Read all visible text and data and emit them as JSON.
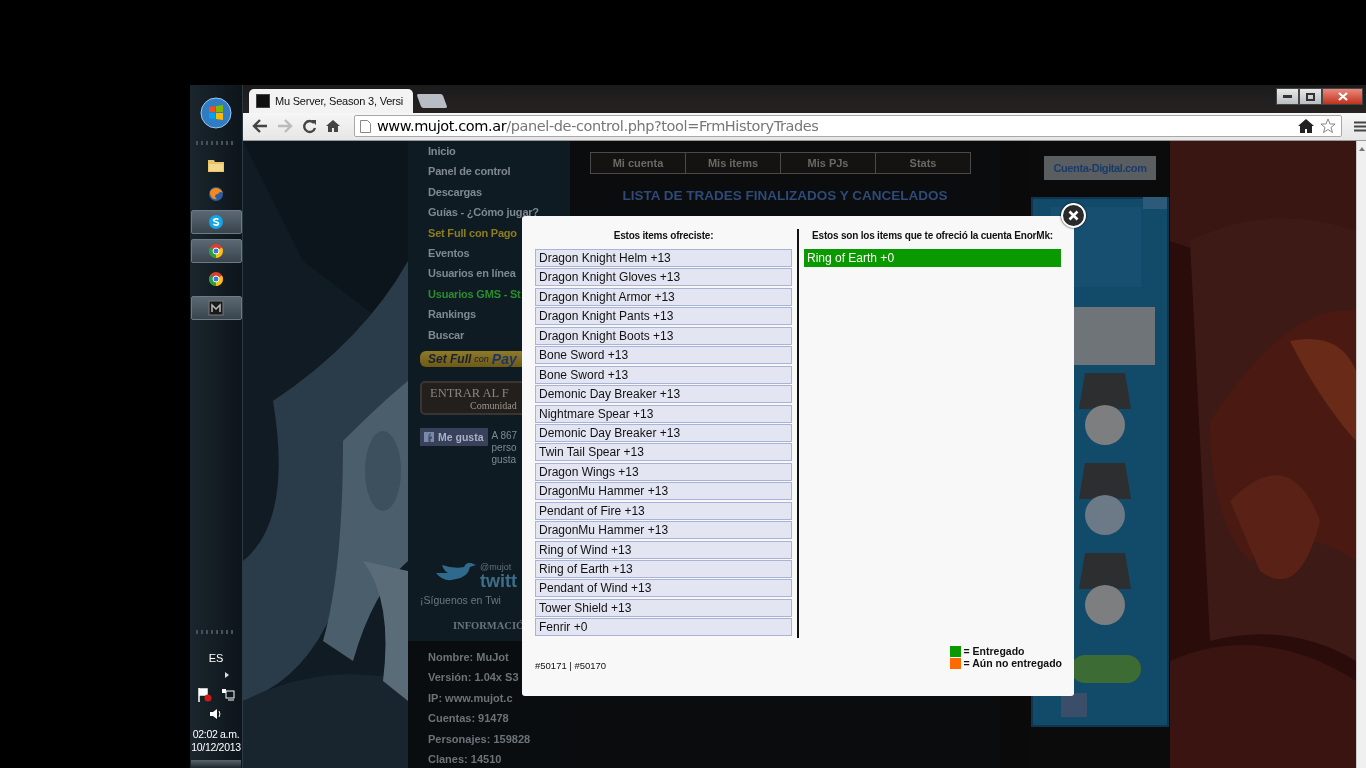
{
  "taskbar": {
    "apps": [
      {
        "kind": "folder",
        "running": false
      },
      {
        "kind": "firefox",
        "running": false
      },
      {
        "kind": "skype",
        "running": true
      },
      {
        "kind": "chrome",
        "running": true
      },
      {
        "kind": "chrome",
        "running": false
      },
      {
        "kind": "game",
        "running": true
      }
    ],
    "language": "ES",
    "time": "02:02 a.m.",
    "date": "10/12/2013"
  },
  "browser": {
    "tab_title": "Mu Server, Season 3, Versi",
    "url_host": "www.mujot.com.ar",
    "url_path": "/panel-de-control.php?tool=FrmHistoryTrades"
  },
  "site": {
    "nav": [
      {
        "label": "Inicio",
        "kind": "normal"
      },
      {
        "label": "Panel de control",
        "kind": "normal"
      },
      {
        "label": "Descargas",
        "kind": "normal"
      },
      {
        "label": "Guías - ¿Cómo jugar?",
        "kind": "normal"
      },
      {
        "label": "Set Full con Pago",
        "kind": "promo"
      },
      {
        "label": "Eventos",
        "kind": "normal"
      },
      {
        "label": "Usuarios en línea",
        "kind": "normal"
      },
      {
        "label": "Usuarios GMS - St",
        "kind": "staff"
      },
      {
        "label": "Rankings",
        "kind": "normal"
      },
      {
        "label": "Buscar",
        "kind": "normal"
      }
    ],
    "paypal_button": {
      "lead": "Set Full",
      "small": "con",
      "brand": "Pay"
    },
    "forum_banner": {
      "title": "ENTRAR AL F",
      "subtitle": "Comunidad"
    },
    "like_button": "Me gusta",
    "like_note": [
      "A 867",
      "perso",
      "gusta"
    ],
    "twitter": {
      "handle": "@mujot",
      "brand": "twitt",
      "follow": "¡Síguenos en Twi"
    },
    "info": {
      "title": "INFORMACIÓ",
      "rows": [
        "Nombre: MuJot",
        "Versión: 1.04x S3",
        "IP: www.mujot.c",
        "Cuentas: 91478",
        "Personajes: 159828",
        "Clanes: 14510"
      ]
    },
    "tabs": [
      "Mi cuenta",
      "Mis items",
      "Mis PJs",
      "Stats"
    ],
    "heading": "LISTA DE TRADES FINALIZADOS Y CANCELADOS",
    "sponsor_logo": "Cuenta-Digital.com"
  },
  "modal": {
    "offered_title": "Estos items ofreciste:",
    "offered": [
      "Dragon Knight Helm +13",
      "Dragon Knight Gloves +13",
      "Dragon Knight Armor +13",
      "Dragon Knight Pants +13",
      "Dragon Knight Boots +13",
      "Bone Sword +13",
      "Bone Sword +13",
      "Demonic Day Breaker +13",
      "Nightmare Spear +13",
      "Demonic Day Breaker +13",
      "Twin Tail Spear +13",
      "Dragon Wings +13",
      "DragonMu Hammer +13",
      "Pendant of Fire +13",
      "DragonMu Hammer +13",
      "Ring of Wind +13",
      "Ring of Earth +13",
      "Pendant of Wind +13",
      "Tower Shield +13",
      "Fenrir +0"
    ],
    "received_title": "Estos son los items que te ofreció la cuenta EnorMk:",
    "received": [
      {
        "name": "Ring of Earth +0",
        "delivered": true
      }
    ],
    "legend": [
      {
        "label": "= Entregado",
        "color": "#0a9a00"
      },
      {
        "label": "= Aún no entregado",
        "color": "#ff6a00"
      }
    ],
    "trade_ids": "#50171 | #50170"
  }
}
